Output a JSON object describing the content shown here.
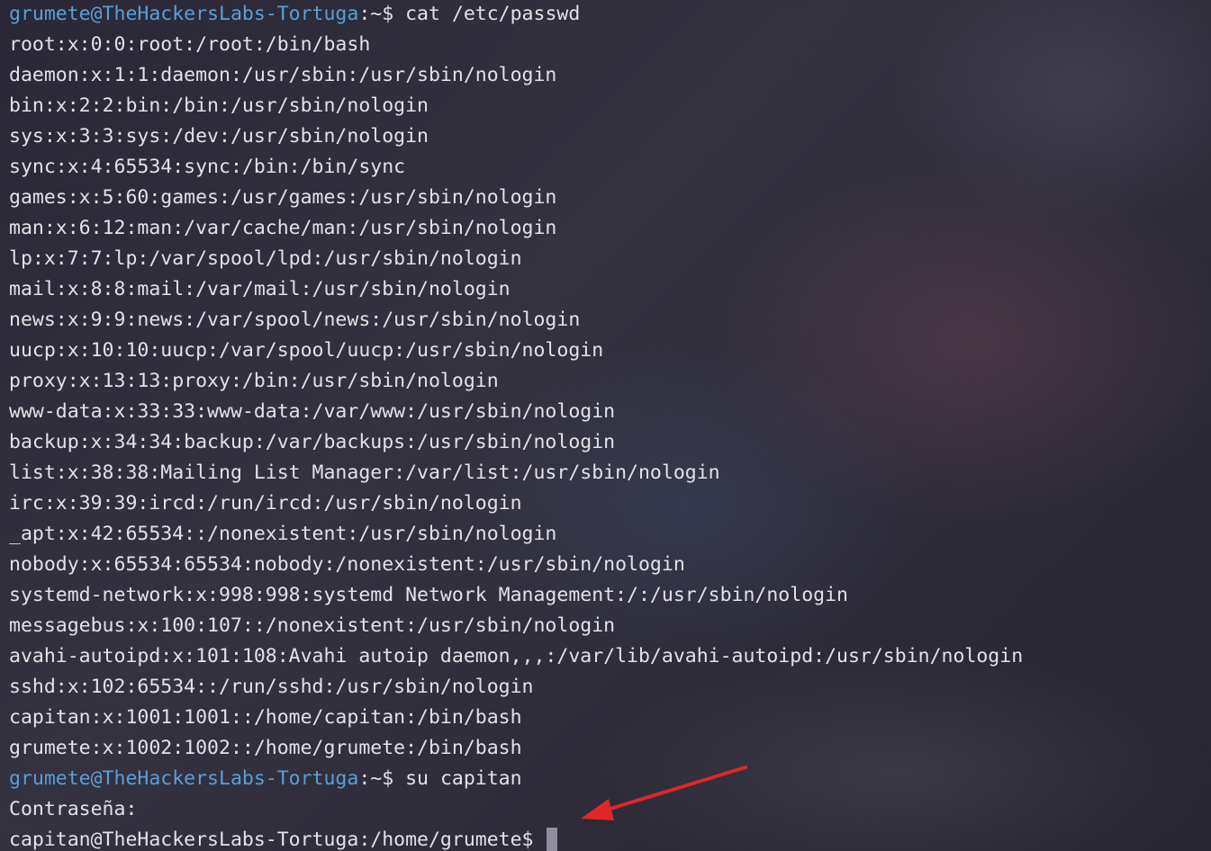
{
  "terminal": {
    "prompt1": {
      "user_host": "grumete@TheHackersLabs-Tortuga",
      "path_sym": ":~$ ",
      "command": "cat /etc/passwd"
    },
    "passwd_lines": [
      "root:x:0:0:root:/root:/bin/bash",
      "daemon:x:1:1:daemon:/usr/sbin:/usr/sbin/nologin",
      "bin:x:2:2:bin:/bin:/usr/sbin/nologin",
      "sys:x:3:3:sys:/dev:/usr/sbin/nologin",
      "sync:x:4:65534:sync:/bin:/bin/sync",
      "games:x:5:60:games:/usr/games:/usr/sbin/nologin",
      "man:x:6:12:man:/var/cache/man:/usr/sbin/nologin",
      "lp:x:7:7:lp:/var/spool/lpd:/usr/sbin/nologin",
      "mail:x:8:8:mail:/var/mail:/usr/sbin/nologin",
      "news:x:9:9:news:/var/spool/news:/usr/sbin/nologin",
      "uucp:x:10:10:uucp:/var/spool/uucp:/usr/sbin/nologin",
      "proxy:x:13:13:proxy:/bin:/usr/sbin/nologin",
      "www-data:x:33:33:www-data:/var/www:/usr/sbin/nologin",
      "backup:x:34:34:backup:/var/backups:/usr/sbin/nologin",
      "list:x:38:38:Mailing List Manager:/var/list:/usr/sbin/nologin",
      "irc:x:39:39:ircd:/run/ircd:/usr/sbin/nologin",
      "_apt:x:42:65534::/nonexistent:/usr/sbin/nologin",
      "nobody:x:65534:65534:nobody:/nonexistent:/usr/sbin/nologin",
      "systemd-network:x:998:998:systemd Network Management:/:/usr/sbin/nologin",
      "messagebus:x:100:107::/nonexistent:/usr/sbin/nologin",
      "avahi-autoipd:x:101:108:Avahi autoip daemon,,,:/var/lib/avahi-autoipd:/usr/sbin/nologin",
      "sshd:x:102:65534::/run/sshd:/usr/sbin/nologin",
      "capitan:x:1001:1001::/home/capitan:/bin/bash",
      "grumete:x:1002:1002::/home/grumete:/bin/bash"
    ],
    "prompt2": {
      "user_host": "grumete@TheHackersLabs-Tortuga",
      "path_sym": ":~$ ",
      "command": "su capitan"
    },
    "password_prompt": "Contraseña:",
    "prompt3": "capitan@TheHackersLabs-Tortuga:/home/grumete$ "
  },
  "colors": {
    "prompt_user": "#5b9fd6",
    "text": "#e2e2e6",
    "arrow": "#e0262a"
  },
  "annotation": {
    "icon": "red-arrow-icon"
  }
}
